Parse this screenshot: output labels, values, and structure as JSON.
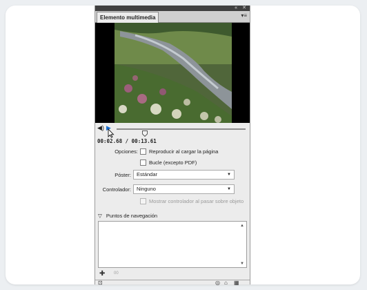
{
  "panel": {
    "collapse_label": "«",
    "close_label": "✕",
    "title": "Elemento multimedia",
    "menu_icon": "▾≡"
  },
  "player": {
    "speaker_glyph": "◀)",
    "play_glyph": "▶",
    "timecode": "00:02.68 / 00:13.61",
    "progress": 0.22
  },
  "options": {
    "label": "Opciones:",
    "play_on_load": "Reproducir al cargar la página",
    "loop": "Bucle (excepto PDF)"
  },
  "poster": {
    "label": "Póster:",
    "value": "Estándar"
  },
  "controller": {
    "label": "Controlador:",
    "value": "Ninguno",
    "show_on_hover": "Mostrar controlador al pasar sobre objeto"
  },
  "nav_points": {
    "title": "Puntos de navegación",
    "toggle_glyph": "▽"
  },
  "bottom": {
    "add_glyph": "✚",
    "add_text": "00"
  },
  "colors": {
    "accent": "#1b6fd1",
    "panel_bg": "#ececec"
  }
}
